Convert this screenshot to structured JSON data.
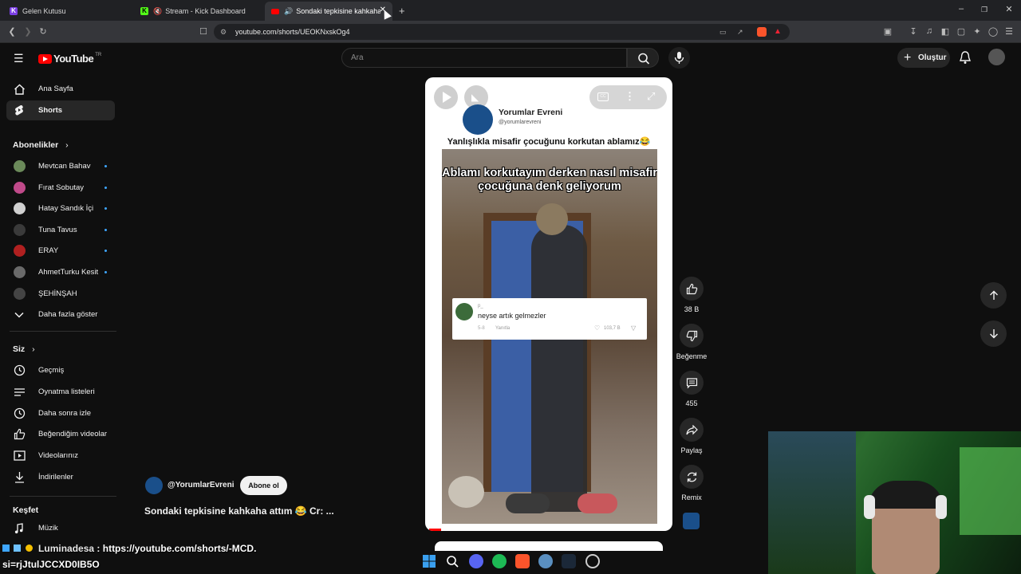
{
  "browser": {
    "tabs": [
      {
        "label": "Gelen Kutusu",
        "favicon": "K"
      },
      {
        "label": "Stream - Kick Dashboard",
        "favicon": "K"
      },
      {
        "label": "Sondaki tepkisine kahkaha att",
        "favicon": "yt"
      }
    ],
    "url": "youtube.com/shorts/UEOKNxskOg4",
    "colors": {
      "tabbar": "#202124",
      "kick": "#53fc18",
      "yt_red": "#ff0000"
    }
  },
  "youtube": {
    "logo_text": "YouTube",
    "logo_sup": "TR",
    "search_placeholder": "Ara",
    "create_label": "Oluştur"
  },
  "sidebar": {
    "main": [
      {
        "label": "Ana Sayfa",
        "icon": "home-icon"
      },
      {
        "label": "Shorts",
        "icon": "shorts-icon"
      }
    ],
    "subscriptions_title": "Abonelikler",
    "subscriptions": [
      {
        "label": "Mevtcan Bahav",
        "color": "#6b8a5a"
      },
      {
        "label": "Fırat Sobutay",
        "color": "#c04a8a"
      },
      {
        "label": "Hatay Sandık İçi",
        "color": "#d0d0d0"
      },
      {
        "label": "Tuna Tavus",
        "color": "#3a3a3a"
      },
      {
        "label": "ERAY",
        "color": "#b02020"
      },
      {
        "label": "AhmetTurku Kesit",
        "color": "#6a6a6a"
      },
      {
        "label": "ŞEHİNŞAH",
        "color": "#444"
      }
    ],
    "show_more": "Daha fazla göster",
    "you_title": "Siz",
    "you_items": [
      {
        "label": "Geçmiş",
        "icon": "history-icon"
      },
      {
        "label": "Oynatma listeleri",
        "icon": "playlist-icon"
      },
      {
        "label": "Daha sonra izle",
        "icon": "clock-icon"
      },
      {
        "label": "Beğendiğim videolar",
        "icon": "thumb-up-icon"
      },
      {
        "label": "Videolarınız",
        "icon": "video-icon"
      },
      {
        "label": "İndirilenler",
        "icon": "download-icon"
      }
    ],
    "explore_title": "Keşfet",
    "explore_items": [
      {
        "label": "Müzik",
        "icon": "music-icon"
      }
    ]
  },
  "short": {
    "channel_name": "Yorumlar Evreni",
    "channel_handle": "@yorumlarevreni",
    "caption": "Yanlışlıkla misafir çocuğunu korkutan ablamız😂",
    "overlay_text": "Ablamı korkutayım derken nasıl misafir çocuğuna denk geliyorum",
    "comment_user": "p_",
    "comment_text": "neyse artık gelmezler",
    "comment_date": "5-8",
    "comment_reply": "Yanıtla",
    "comment_likes": "103,7 B",
    "bottom_channel": "@YorumlarEvreni",
    "subscribe_label": "Abone ol",
    "bottom_title": "Sondaki tepkisine kahkaha attım 😂 Cr: ..."
  },
  "actions": {
    "likes": "38 B",
    "dislike": "Beğenme",
    "comments": "455",
    "share": "Paylaş",
    "remix": "Remix"
  },
  "chat_overlay": {
    "user": "Luminadesa",
    "message_line1": ": https://youtube.com/shorts/-MCD.",
    "message_line2": "si=rjJtulJCCXD0IB5O"
  }
}
